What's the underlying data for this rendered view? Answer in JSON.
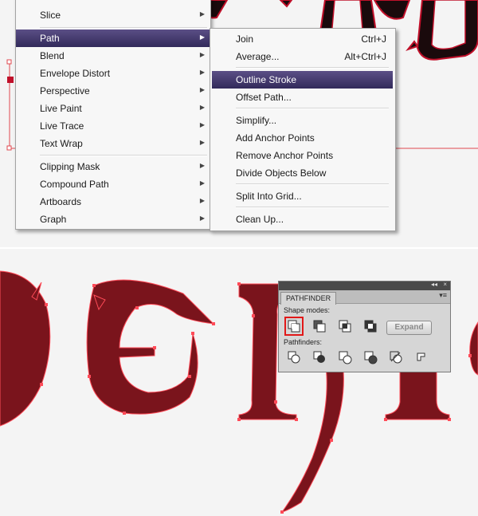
{
  "menu": {
    "items": [
      {
        "label": "Slice",
        "submenu": true
      },
      {
        "label": "Path",
        "submenu": true,
        "highlighted": true
      },
      {
        "label": "Blend",
        "submenu": true
      },
      {
        "label": "Envelope Distort",
        "submenu": true
      },
      {
        "label": "Perspective",
        "submenu": true
      },
      {
        "label": "Live Paint",
        "submenu": true
      },
      {
        "label": "Live Trace",
        "submenu": true
      },
      {
        "label": "Text Wrap",
        "submenu": true
      },
      {
        "label": "Clipping Mask",
        "submenu": true
      },
      {
        "label": "Compound Path",
        "submenu": true
      },
      {
        "label": "Artboards",
        "submenu": true
      },
      {
        "label": "Graph",
        "submenu": true
      }
    ],
    "submenu_arrow": "▶"
  },
  "path_submenu": {
    "items": [
      {
        "label": "Join",
        "shortcut": "Ctrl+J"
      },
      {
        "label": "Average...",
        "shortcut": "Alt+Ctrl+J"
      },
      {
        "label": "Outline Stroke",
        "shortcut": "",
        "highlighted": true
      },
      {
        "label": "Offset Path...",
        "shortcut": ""
      },
      {
        "label": "Simplify...",
        "shortcut": ""
      },
      {
        "label": "Add Anchor Points",
        "shortcut": ""
      },
      {
        "label": "Remove Anchor Points",
        "shortcut": ""
      },
      {
        "label": "Divide Objects Below",
        "shortcut": ""
      },
      {
        "label": "Split Into Grid...",
        "shortcut": ""
      },
      {
        "label": "Clean Up...",
        "shortcut": ""
      }
    ]
  },
  "pathfinder": {
    "tab": "PATHFINDER",
    "shape_modes_label": "Shape modes:",
    "pathfinders_label": "Pathfinders:",
    "expand_label": "Expand",
    "collapse_glyph": "◂◂",
    "close_glyph": "×",
    "menu_glyph": "▾≡",
    "shape_mode_icons": [
      "unite-icon",
      "minus-front-icon",
      "intersect-icon",
      "exclude-icon"
    ],
    "selected_shape_mode": "unite-icon",
    "pathfinder_icons": [
      "divide-icon",
      "trim-icon",
      "merge-icon",
      "crop-icon",
      "outline-icon",
      "minus-back-icon"
    ]
  },
  "colors": {
    "letter_fill": "#7a141c",
    "anchor": "#ff3b4a",
    "menu_highlight": "#3f3569",
    "selection_outline": "#e11818"
  }
}
